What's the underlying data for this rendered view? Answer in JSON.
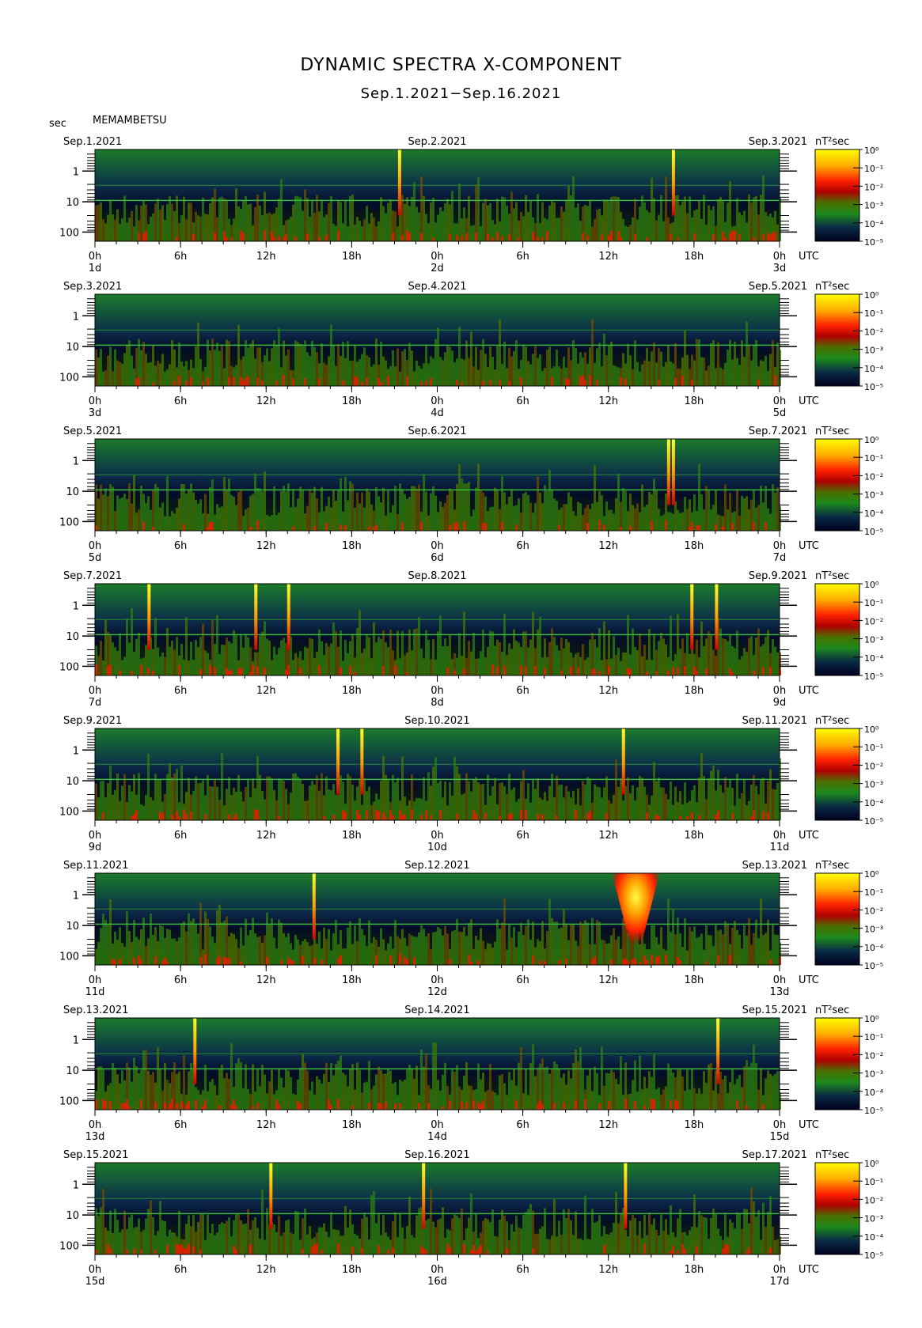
{
  "title": "DYNAMIC SPECTRA X-COMPONENT",
  "subtitle": "Sep.1.2021−Sep.16.2021",
  "y_axis_unit_label": "sec",
  "station": "MEMAMBETSU",
  "x_axis_unit_label": "UTC",
  "colorbar_unit_label": "nT²sec",
  "chart_data": {
    "type": "heatmap",
    "x_tick_labels": [
      "0h",
      "6h",
      "12h",
      "18h",
      "0h",
      "6h",
      "12h",
      "18h",
      "0h"
    ],
    "y_tick_labels": [
      "1",
      "10",
      "100"
    ],
    "y_scale": "log",
    "colorbar_tick_labels": [
      "10⁰",
      "10⁻¹",
      "10⁻²",
      "10⁻³",
      "10⁻⁴",
      "10⁻⁵"
    ],
    "colormap": [
      "#ffff00",
      "#ffaa00",
      "#ff2200",
      "#c80000",
      "#4a6f00",
      "#1c8a1c",
      "#0a2a45",
      "#00001e"
    ],
    "panels": [
      {
        "start_label": "Sep.1.2021",
        "mid_label": "Sep.2.2021",
        "end_label": "Sep.3.2021",
        "start_day": "1d",
        "mid_day": "2d",
        "end_day": "3d",
        "spikes": [
          0.445,
          0.845
        ]
      },
      {
        "start_label": "Sep.3.2021",
        "mid_label": "Sep.4.2021",
        "end_label": "Sep.5.2021",
        "start_day": "3d",
        "mid_day": "4d",
        "end_day": "5d",
        "spikes": []
      },
      {
        "start_label": "Sep.5.2021",
        "mid_label": "Sep.6.2021",
        "end_label": "Sep.7.2021",
        "start_day": "5d",
        "mid_day": "6d",
        "end_day": "7d",
        "spikes": [
          0.838,
          0.845
        ]
      },
      {
        "start_label": "Sep.7.2021",
        "mid_label": "Sep.8.2021",
        "end_label": "Sep.9.2021",
        "start_day": "7d",
        "mid_day": "8d",
        "end_day": "9d",
        "spikes": [
          0.079,
          0.235,
          0.283,
          0.872,
          0.908
        ]
      },
      {
        "start_label": "Sep.9.2021",
        "mid_label": "Sep.10.2021",
        "end_label": "Sep.11.2021",
        "start_day": "9d",
        "mid_day": "10d",
        "end_day": "11d",
        "spikes": [
          0.355,
          0.39,
          0.772
        ]
      },
      {
        "start_label": "Sep.11.2021",
        "mid_label": "Sep.12.2021",
        "end_label": "Sep.13.2021",
        "start_day": "11d",
        "mid_day": "12d",
        "end_day": "13d",
        "spikes": [
          0.32
        ],
        "storm": 0.79
      },
      {
        "start_label": "Sep.13.2021",
        "mid_label": "Sep.14.2021",
        "end_label": "Sep.15.2021",
        "start_day": "13d",
        "mid_day": "14d",
        "end_day": "15d",
        "spikes": [
          0.146,
          0.91
        ]
      },
      {
        "start_label": "Sep.15.2021",
        "mid_label": "Sep.16.2021",
        "end_label": "Sep.17.2021",
        "start_day": "15d",
        "mid_day": "16d",
        "end_day": "17d",
        "spikes": [
          0.257,
          0.48,
          0.775
        ]
      }
    ]
  }
}
